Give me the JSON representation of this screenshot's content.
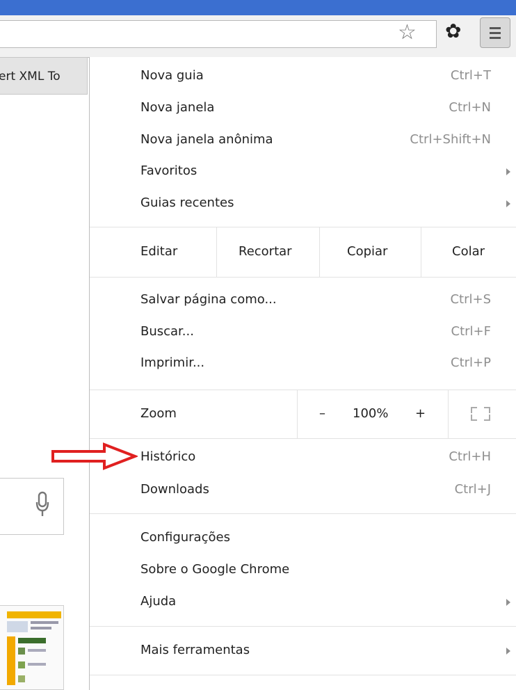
{
  "tab": {
    "title": "ert XML To"
  },
  "toolbar": {
    "star_icon": "star-outline-icon",
    "gear_icon": "gear-icon",
    "menu_icon": "hamburger-menu-icon"
  },
  "menu": {
    "group1": [
      {
        "label": "Nova guia",
        "shortcut": "Ctrl+T"
      },
      {
        "label": "Nova janela",
        "shortcut": "Ctrl+N"
      },
      {
        "label": "Nova janela anônima",
        "shortcut": "Ctrl+Shift+N"
      },
      {
        "label": "Favoritos",
        "submenu": true
      },
      {
        "label": "Guias recentes",
        "submenu": true
      }
    ],
    "edit": {
      "label": "Editar",
      "cut": "Recortar",
      "copy": "Copiar",
      "paste": "Colar"
    },
    "group2": [
      {
        "label": "Salvar página como...",
        "shortcut": "Ctrl+S"
      },
      {
        "label": "Buscar...",
        "shortcut": "Ctrl+F"
      },
      {
        "label": "Imprimir...",
        "shortcut": "Ctrl+P"
      }
    ],
    "zoom": {
      "label": "Zoom",
      "minus": "–",
      "value": "100%",
      "plus": "+"
    },
    "group3": [
      {
        "label": "Histórico",
        "shortcut": "Ctrl+H"
      },
      {
        "label": "Downloads",
        "shortcut": "Ctrl+J"
      }
    ],
    "group4": [
      {
        "label": "Configurações"
      },
      {
        "label": "Sobre o Google Chrome"
      },
      {
        "label": "Ajuda",
        "submenu": true
      }
    ],
    "group5": [
      {
        "label": "Mais ferramentas",
        "submenu": true
      }
    ]
  },
  "colors": {
    "accent": "#3b6fd0",
    "annotation_arrow": "#e02020",
    "shortcut": "#8f8f8f"
  }
}
